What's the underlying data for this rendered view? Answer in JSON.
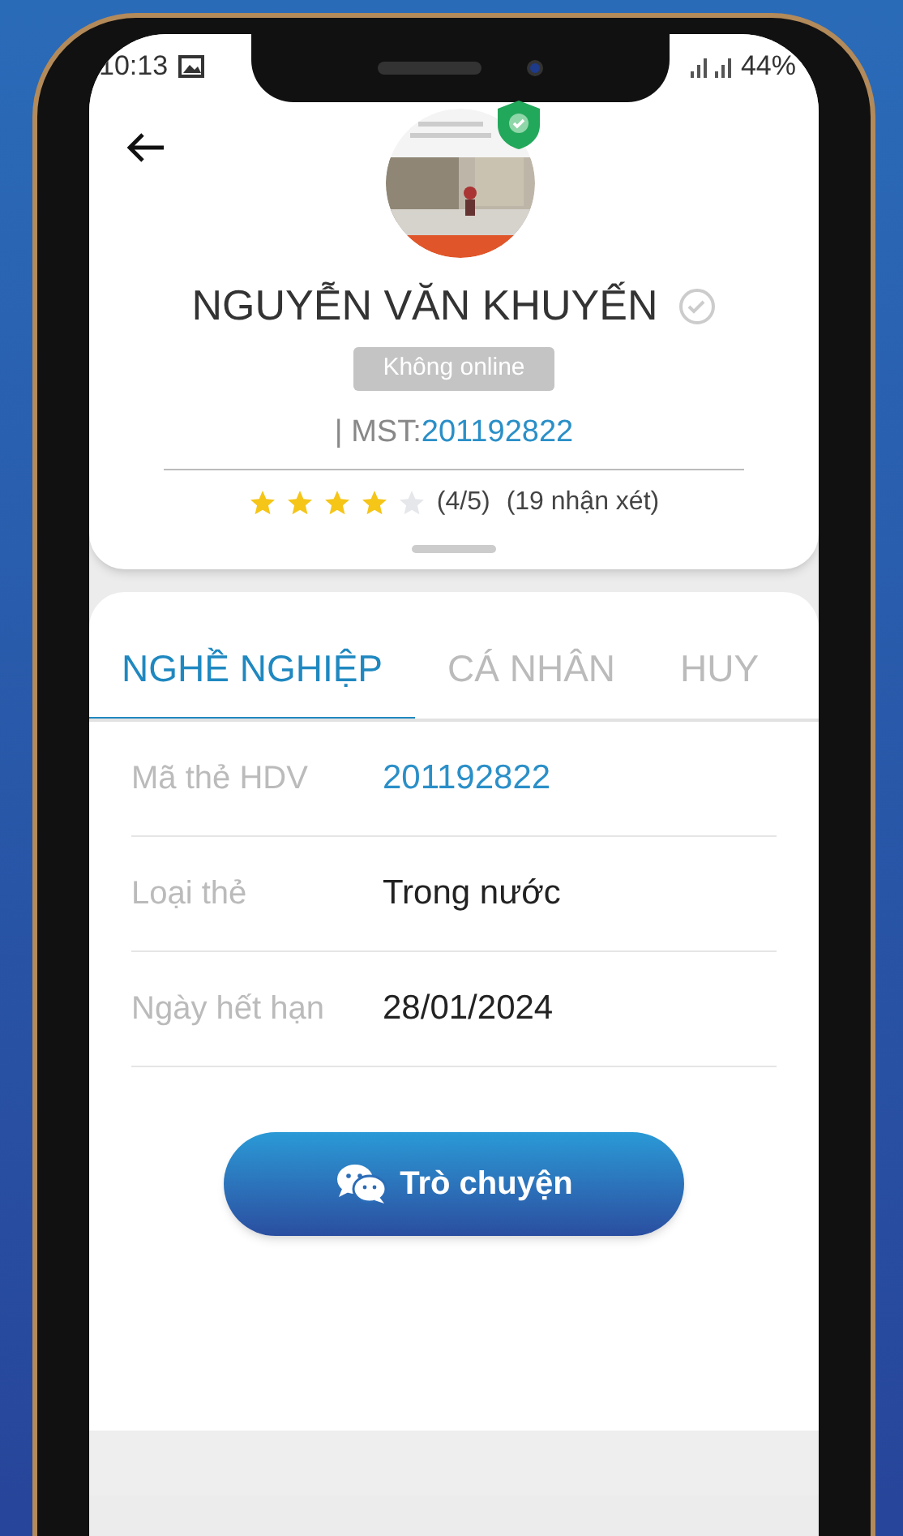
{
  "status_bar": {
    "time": "10:13",
    "battery": "44%"
  },
  "profile": {
    "name": "NGUYỄN VĂN KHUYẾN",
    "verified": true,
    "status": "Không online",
    "mst_label": "| MST:",
    "mst": "201192822",
    "stars": 4,
    "rating": "(4/5)",
    "reviews": "(19 nhận xét)"
  },
  "tabs": [
    {
      "label": "NGHỀ NGHIỆP",
      "selected": true
    },
    {
      "label": "CÁ NHÂN",
      "selected": false
    },
    {
      "label": "HUY",
      "selected": false
    }
  ],
  "fields": [
    {
      "label": "Mã thẻ HDV",
      "value": "201192822",
      "kind": "link"
    },
    {
      "label": "Loại thẻ",
      "value": "Trong nước",
      "kind": "text"
    },
    {
      "label": "Ngày hết hạn",
      "value": "28/01/2024",
      "kind": "text"
    }
  ],
  "chat_button": {
    "label": "Trò chuyện"
  }
}
